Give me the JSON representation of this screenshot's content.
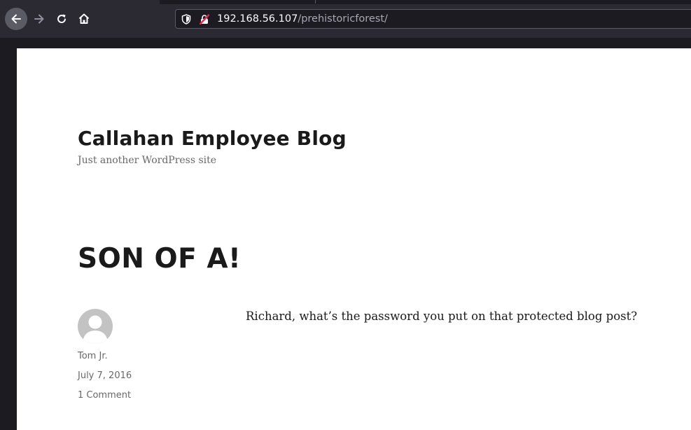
{
  "browser": {
    "nav_icons": [
      "arrow-left-icon",
      "arrow-right-icon",
      "reload-icon",
      "home-icon"
    ],
    "address_bar": {
      "host": "192.168.56.107",
      "path": "/prehistoricforest/",
      "icons": [
        "shield-icon",
        "insecure-lock-icon"
      ]
    }
  },
  "site": {
    "title": "Callahan Employee Blog",
    "tagline": "Just another WordPress site"
  },
  "post": {
    "title": "SON OF A!",
    "author": "Tom Jr.",
    "date": "July 7, 2016",
    "comments": "1 Comment",
    "body": "Richard, what’s the password you put on that protected blog post?"
  },
  "colors": {
    "toolbar": "#2b2a33",
    "chrome_dark": "#1c1b22",
    "page_background": "#ffffff",
    "title_text": "#1a1a1a",
    "meta_text": "#686868",
    "insecure_lock": "#e22850"
  }
}
